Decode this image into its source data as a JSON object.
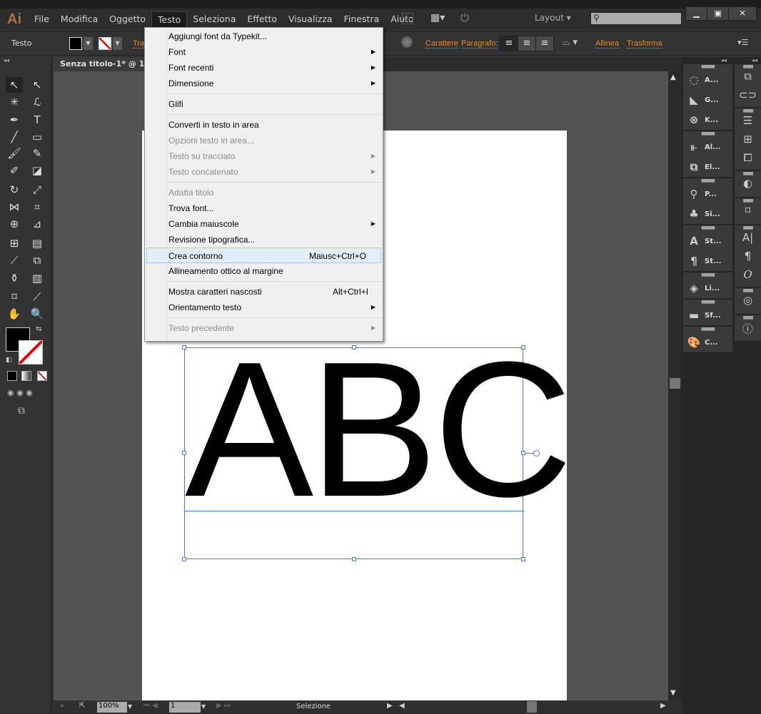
{
  "app": {
    "logo": "Ai"
  },
  "menubar": {
    "items": [
      "File",
      "Modifica",
      "Oggetto",
      "Testo",
      "Seleziona",
      "Effetto",
      "Visualizza",
      "Finestra",
      "Aiuto"
    ],
    "active": "Testo",
    "bridge": "Br",
    "workspace": "Layout",
    "search_placeholder": ""
  },
  "controlbar": {
    "label": "Testo",
    "stroke_label": "Tra",
    "carattere": "Carattere",
    "paragrafo": "Paragrafo:",
    "allinea": "Allinea",
    "trasforma": "Trasforma"
  },
  "document": {
    "tab": "Senza titolo-1* @ 100%",
    "artwork_text": "ABC"
  },
  "menu": {
    "items": [
      {
        "label": "Aggiungi font da Typekit...",
        "enabled": true
      },
      {
        "label": "Font",
        "enabled": true,
        "submenu": true
      },
      {
        "label": "Font recenti",
        "enabled": true,
        "submenu": true
      },
      {
        "label": "Dimensione",
        "enabled": true,
        "submenu": true,
        "sep_after": true
      },
      {
        "label": "Glifi",
        "enabled": true,
        "sep_after": true
      },
      {
        "label": "Converti in testo in area",
        "enabled": true
      },
      {
        "label": "Opzioni testo in area...",
        "enabled": false
      },
      {
        "label": "Testo su tracciato",
        "enabled": false,
        "submenu": true
      },
      {
        "label": "Testo concatenato",
        "enabled": false,
        "submenu": true,
        "sep_after": true
      },
      {
        "label": "Adatta titolo",
        "enabled": false
      },
      {
        "label": "Trova font...",
        "enabled": true
      },
      {
        "label": "Cambia maiuscole",
        "enabled": true,
        "submenu": true
      },
      {
        "label": "Revisione tipografica...",
        "enabled": true
      },
      {
        "label": "Crea contorno",
        "enabled": true,
        "shortcut": "Maiusc+Ctrl+O",
        "highlighted": true
      },
      {
        "label": "Allineamento ottico al margine",
        "enabled": true,
        "sep_after": true
      },
      {
        "label": "Mostra caratteri nascosti",
        "enabled": true,
        "shortcut": "Alt+Ctrl+I"
      },
      {
        "label": "Orientamento testo",
        "enabled": true,
        "submenu": true,
        "sep_after": true
      },
      {
        "label": "Testo precedente",
        "enabled": false,
        "submenu": true
      }
    ]
  },
  "panels": {
    "left_col": [
      {
        "items": [
          {
            "icon": "appearance-icon",
            "label": "A..."
          },
          {
            "icon": "gradient-icon",
            "label": "G..."
          },
          {
            "icon": "cc-libraries-icon",
            "label": "K..."
          }
        ]
      },
      {
        "items": [
          {
            "icon": "align-icon",
            "label": "Al..."
          },
          {
            "icon": "links-icon",
            "label": "El..."
          }
        ]
      },
      {
        "items": [
          {
            "icon": "brushes-icon",
            "label": "P..."
          },
          {
            "icon": "symbols-icon",
            "label": "Si..."
          }
        ]
      },
      {
        "items": [
          {
            "icon": "character-styles-icon",
            "label": "St..."
          },
          {
            "icon": "paragraph-styles-icon",
            "label": "St..."
          }
        ]
      },
      {
        "items": [
          {
            "icon": "layers-icon",
            "label": "Li..."
          }
        ]
      },
      {
        "items": [
          {
            "icon": "gradient-swatch-icon",
            "label": "Sf..."
          }
        ]
      },
      {
        "items": [
          {
            "icon": "color-palette-icon",
            "label": "C..."
          }
        ]
      }
    ]
  },
  "statusbar": {
    "zoom": "100%",
    "page": "1",
    "tool": "Selezione"
  }
}
